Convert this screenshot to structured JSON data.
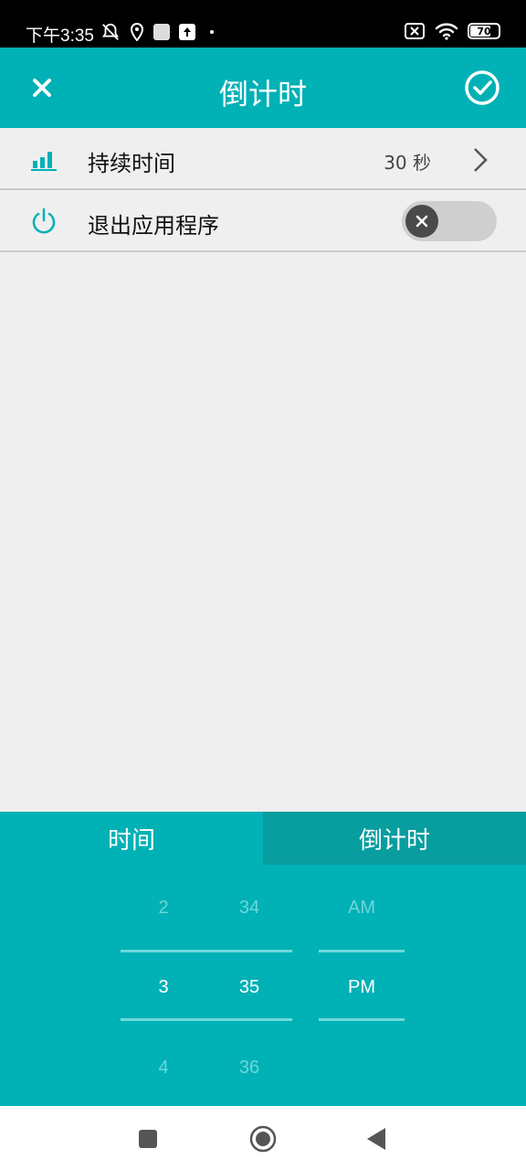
{
  "status_bar": {
    "time": "下午3:35",
    "battery": "70"
  },
  "app_bar": {
    "title": "倒计时"
  },
  "settings": {
    "duration": {
      "label": "持续时间",
      "value": "30 秒"
    },
    "exit_app": {
      "label": "退出应用程序",
      "enabled": false
    }
  },
  "tabs": {
    "time": "时间",
    "countdown": "倒计时",
    "active": "countdown"
  },
  "picker": {
    "hours": {
      "prev": "2",
      "selected": "3",
      "next": "4"
    },
    "minutes": {
      "prev": "34",
      "selected": "35",
      "next": "36"
    },
    "ampm": {
      "prev": "AM",
      "selected": "PM"
    }
  },
  "colors": {
    "accent": "#00b1b5",
    "accent_dark": "#089d9f",
    "background": "#efefef"
  }
}
